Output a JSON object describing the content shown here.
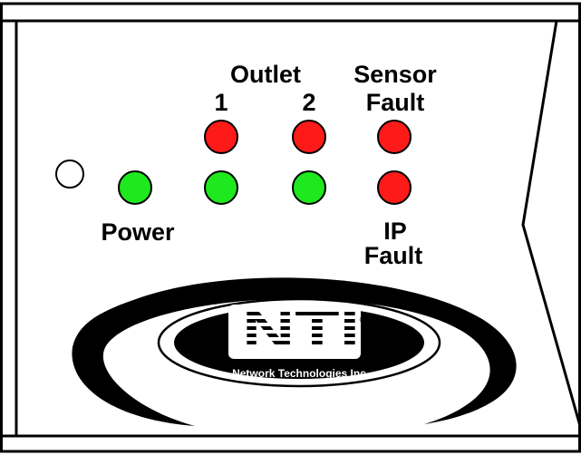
{
  "labels": {
    "outlet": "Outlet",
    "outlet_1": "1",
    "outlet_2": "2",
    "sensor": "Sensor",
    "sensor_fault": "Fault",
    "power": "Power",
    "ip": "IP",
    "ip_fault": "Fault"
  },
  "leds": {
    "power": {
      "color": "#1ee81e",
      "state": "on"
    },
    "outlet_1_top": {
      "color": "#ff1a1a",
      "state": "on"
    },
    "outlet_1_bottom": {
      "color": "#1ee81e",
      "state": "on"
    },
    "outlet_2_top": {
      "color": "#ff1a1a",
      "state": "on"
    },
    "outlet_2_bottom": {
      "color": "#1ee81e",
      "state": "on"
    },
    "sensor_fault": {
      "color": "#ff1a1a",
      "state": "on"
    },
    "ip_fault": {
      "color": "#ff1a1a",
      "state": "on"
    },
    "indicator_hole": {
      "color": "#ffffff",
      "state": "off"
    }
  },
  "logo": {
    "company": "Network Technologies Inc",
    "registered_mark": "®",
    "letters": "NTI"
  },
  "colors": {
    "outline": "#000000",
    "background": "#ffffff",
    "led_green": "#1ee81e",
    "led_red": "#ff1a1a"
  }
}
